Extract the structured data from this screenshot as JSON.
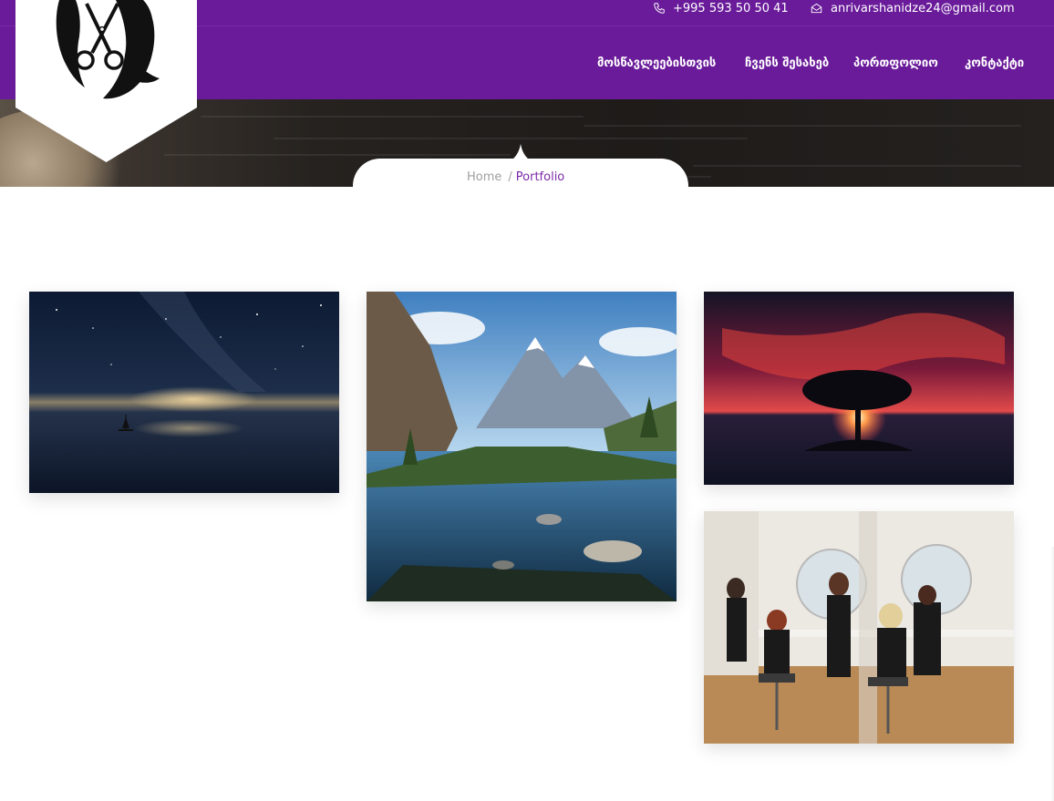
{
  "topbar": {
    "phone": "+995 593 50 50 41",
    "email": "anrivarshanidze24@gmail.com",
    "phone_icon": "phone-icon",
    "email_icon": "envelope-icon"
  },
  "nav": {
    "items": [
      {
        "label": "მოსწავლეებისთვის"
      },
      {
        "label": "ჩვენს შესახებ"
      },
      {
        "label": "პორთფოლიო"
      },
      {
        "label": "კონტაქტი"
      }
    ]
  },
  "logo": {
    "icon": "hair-salon-scissors-logo"
  },
  "breadcrumb": {
    "home": "Home",
    "separator": "/",
    "current": "Portfolio"
  },
  "gallery": [
    {
      "subject": "starry night sea with sailboat"
    },
    {
      "subject": "mountain lake landscape"
    },
    {
      "subject": "tree silhouette at red sunset"
    },
    {
      "subject": "hair salon with stylists"
    }
  ],
  "colors": {
    "brand_purple": "#6a1b9a",
    "breadcrumb_active": "#7b2aa7",
    "breadcrumb_muted": "#9e9e9e"
  }
}
